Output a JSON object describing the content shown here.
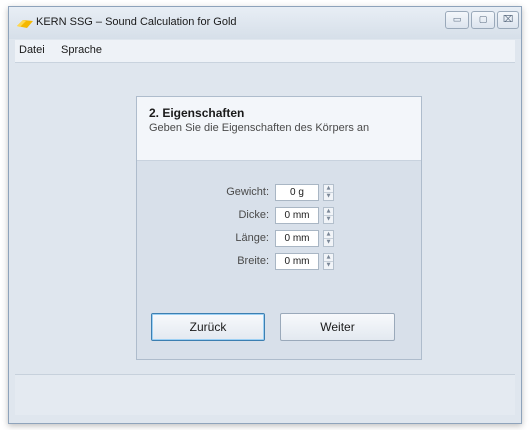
{
  "window": {
    "title": "KERN SSG – Sound Calculation for Gold",
    "controls": {
      "minimize": "▭",
      "maximize": "▢",
      "close": "⌧"
    },
    "icon": "app-icon"
  },
  "menu": {
    "items": [
      "Datei",
      "Sprache"
    ]
  },
  "panel": {
    "title": "2. Eigenschaften",
    "subtitle": "Geben Sie die Eigenschaften des Körpers an",
    "fields": [
      {
        "label": "Gewicht:",
        "value": "0 g"
      },
      {
        "label": "Dicke:",
        "value": "0 mm"
      },
      {
        "label": "Länge:",
        "value": "0 mm"
      },
      {
        "label": "Breite:",
        "value": "0 mm"
      }
    ],
    "buttons": {
      "back": "Zurück",
      "next": "Weiter"
    }
  },
  "colors": {
    "accent": "#f5b800",
    "window_bg": "#dfe6ee",
    "panel_bg": "#d8e0ea",
    "focus": "#3c7fb1"
  }
}
